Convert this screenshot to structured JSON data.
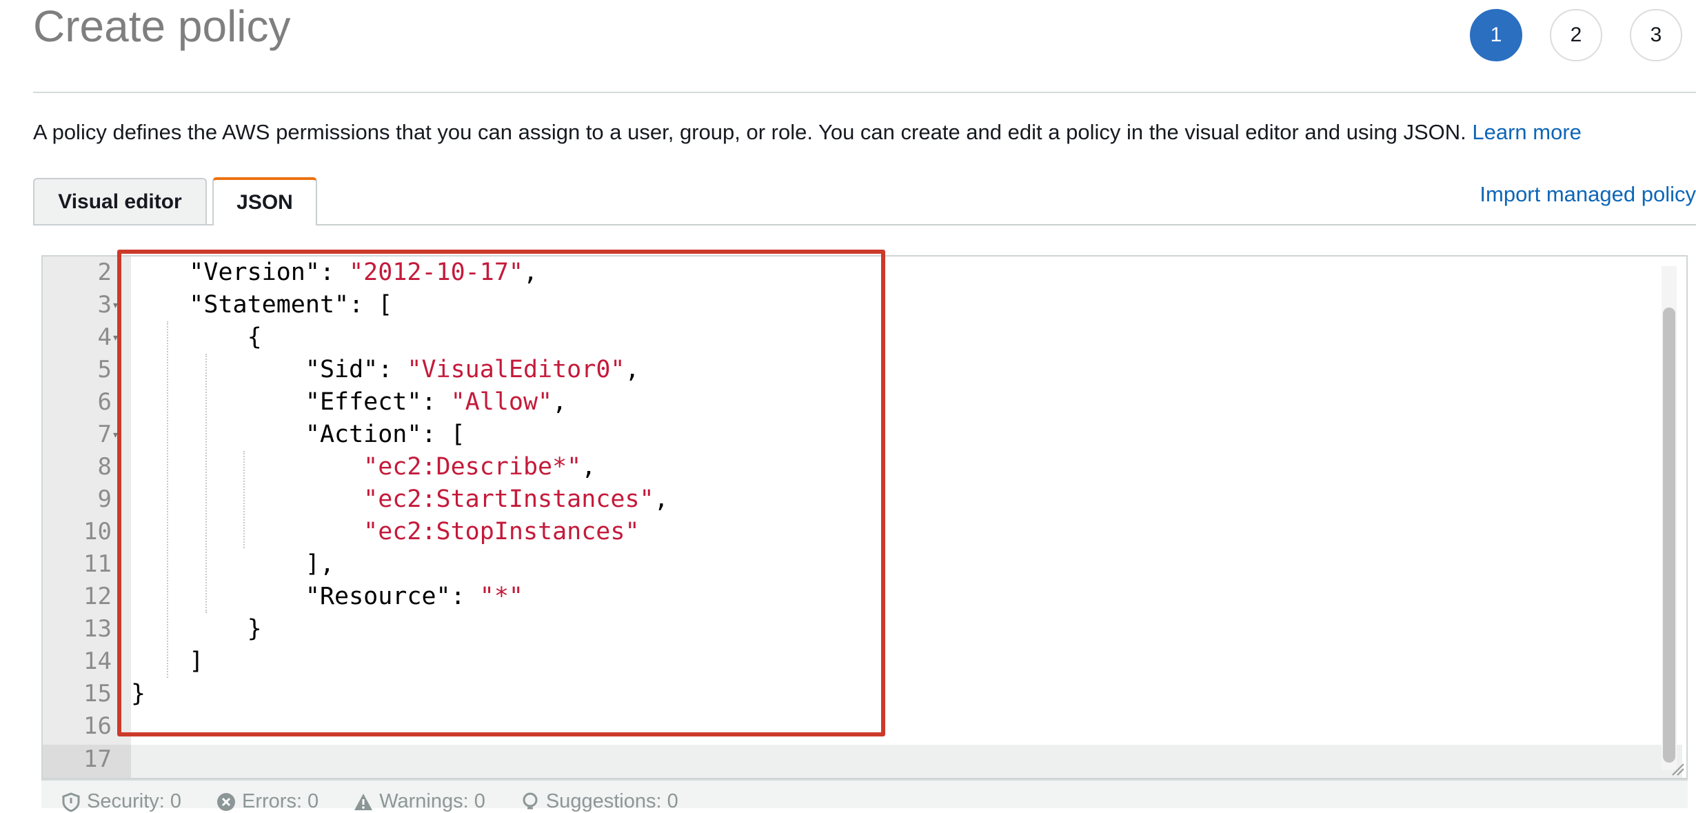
{
  "page": {
    "title": "Create policy",
    "steps": [
      "1",
      "2",
      "3"
    ],
    "description": "A policy defines the AWS permissions that you can assign to a user, group, or role. You can create and edit a policy in the visual editor and using JSON. ",
    "learn_more": "Learn more"
  },
  "tabs": {
    "visual_editor": "Visual editor",
    "json": "JSON",
    "active": "JSON"
  },
  "import_link": "Import managed policy",
  "editor": {
    "line_numbers": [
      "2",
      "3",
      "4",
      "5",
      "6",
      "7",
      "8",
      "9",
      "10",
      "11",
      "12",
      "13",
      "14",
      "15",
      "16",
      "17"
    ],
    "lines": [
      {
        "indent": "    ",
        "key": "\"Version\"",
        "punct1": ": ",
        "value": "\"2012-10-17\"",
        "punct2": ","
      },
      {
        "indent": "    ",
        "key": "\"Statement\"",
        "punct1": ": [",
        "value": "",
        "punct2": ""
      },
      {
        "indent": "        ",
        "key": "",
        "punct1": "{",
        "value": "",
        "punct2": ""
      },
      {
        "indent": "            ",
        "key": "\"Sid\"",
        "punct1": ": ",
        "value": "\"VisualEditor0\"",
        "punct2": ","
      },
      {
        "indent": "            ",
        "key": "\"Effect\"",
        "punct1": ": ",
        "value": "\"Allow\"",
        "punct2": ","
      },
      {
        "indent": "            ",
        "key": "\"Action\"",
        "punct1": ": [",
        "value": "",
        "punct2": ""
      },
      {
        "indent": "                ",
        "key": "",
        "punct1": "",
        "value": "\"ec2:Describe*\"",
        "punct2": ","
      },
      {
        "indent": "                ",
        "key": "",
        "punct1": "",
        "value": "\"ec2:StartInstances\"",
        "punct2": ","
      },
      {
        "indent": "                ",
        "key": "",
        "punct1": "",
        "value": "\"ec2:StopInstances\"",
        "punct2": ""
      },
      {
        "indent": "            ",
        "key": "",
        "punct1": "],",
        "value": "",
        "punct2": ""
      },
      {
        "indent": "            ",
        "key": "\"Resource\"",
        "punct1": ": ",
        "value": "\"*\"",
        "punct2": ""
      },
      {
        "indent": "        ",
        "key": "",
        "punct1": "}",
        "value": "",
        "punct2": ""
      },
      {
        "indent": "    ",
        "key": "",
        "punct1": "]",
        "value": "",
        "punct2": ""
      },
      {
        "indent": "",
        "key": "",
        "punct1": "}",
        "value": "",
        "punct2": ""
      },
      {
        "indent": "",
        "key": "",
        "punct1": "",
        "value": "",
        "punct2": ""
      },
      {
        "indent": "",
        "key": "",
        "punct1": "",
        "value": "",
        "punct2": ""
      }
    ],
    "string_color": "#c41a3a",
    "highlight_color": "#cc3a2a"
  },
  "status_bar": {
    "security": "Security: 0",
    "errors": "Errors: 0",
    "warnings": "Warnings: 0",
    "suggestions": "Suggestions: 0"
  },
  "colors": {
    "accent": "#2b6fc1",
    "link": "#0d66b8",
    "tab_active_border": "#ec7211"
  },
  "icons": [
    "shield-icon",
    "error-circle-icon",
    "warning-triangle-icon",
    "lightbulb-icon",
    "fold-arrow-icon",
    "resize-grip-icon"
  ]
}
